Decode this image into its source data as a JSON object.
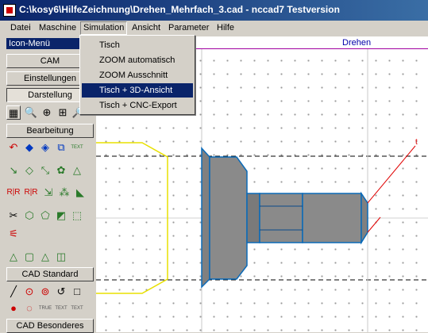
{
  "window": {
    "title": "C:\\kosy6\\HilfeZeichnung\\Drehen_Mehrfach_3.cad - nccad7 Testversion"
  },
  "menu": {
    "items": [
      "Datei",
      "Maschine",
      "Simulation",
      "Ansicht",
      "Parameter",
      "Hilfe"
    ],
    "open": "Simulation"
  },
  "simulation_menu": {
    "items": [
      "Tisch",
      "ZOOM automatisch",
      "ZOOM Ausschnitt",
      "Tisch + 3D-Ansicht",
      "Tisch + CNC-Export"
    ],
    "highlighted": "Tisch + 3D-Ansicht"
  },
  "palette": {
    "header": "Icon-Menü",
    "buttons": {
      "cam": "CAM",
      "einstellungen": "Einstellungen",
      "darstellung": "Darstellung",
      "bearbeitung": "Bearbeitung",
      "cad_standard": "CAD Standard",
      "cad_besonderes": "CAD Besonderes"
    },
    "text_icon_label": "TEXT",
    "true_icon_label": "TRUE"
  },
  "canvas": {
    "view_label": "Drehen",
    "tool_marker": "t"
  },
  "colors": {
    "titlebar_start": "#0a246a",
    "titlebar_end": "#3a6ea5",
    "menu_highlight": "#0a246a",
    "part_fill": "#808080",
    "part_edge": "#0a6ab8",
    "stock_outline": "#e8e000",
    "tool_path": "#e00000"
  }
}
